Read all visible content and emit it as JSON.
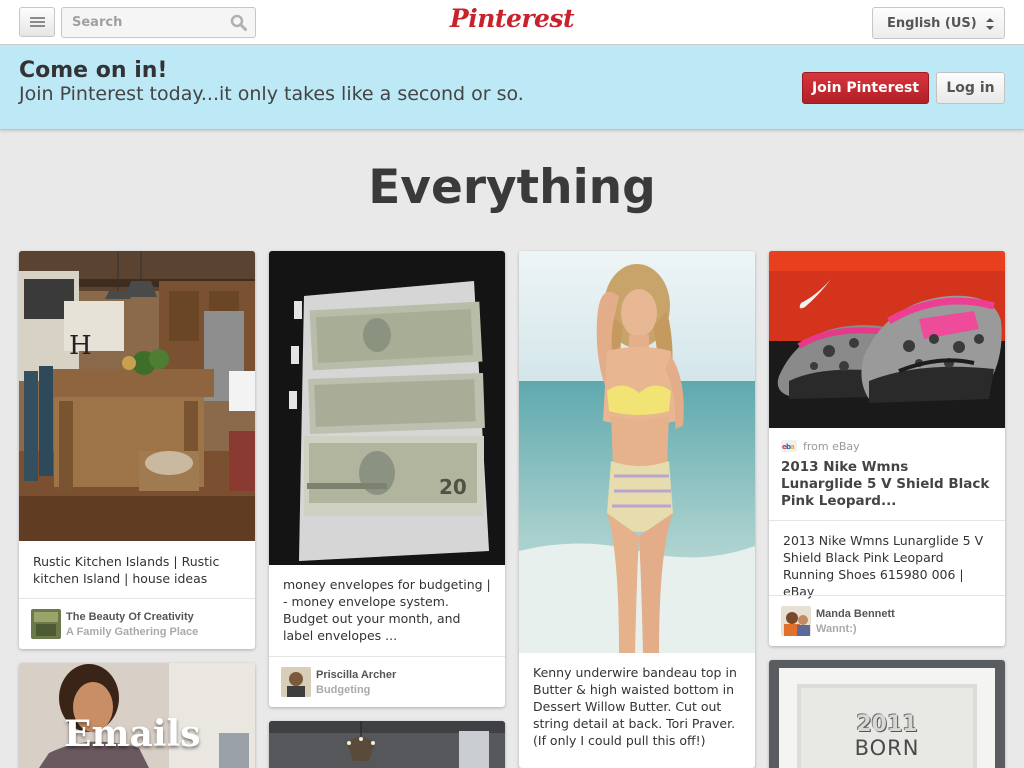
{
  "header": {
    "search_placeholder": "Search",
    "logo_text": "Pinterest",
    "language": "English (US)"
  },
  "banner": {
    "title": "Come on in!",
    "subtitle": "Join Pinterest today...it only takes like a second or so.",
    "join_label": "Join Pinterest",
    "login_label": "Log in"
  },
  "page": {
    "title": "Everything"
  },
  "pins": [
    {
      "description": "Rustic Kitchen Islands | Rustic kitchen Island | house ideas",
      "user": "The Beauty Of Creativity",
      "board": "A Family Gathering Place"
    },
    {
      "description": "money envelopes for budgeting | - money envelope system. Budget out your month, and label envelopes ...",
      "user": "Priscilla Archer",
      "board": "Budgeting"
    },
    {
      "description": "Kenny underwire bandeau top in Butter & high waisted bottom in Dessert Willow Butter. Cut out string detail at back. Tori Praver. (If only I could pull this off!)"
    },
    {
      "source": "from eBay",
      "title": "2013 Nike Wmns Lunarglide 5 V Shield Black Pink Leopard...",
      "description": "2013 Nike Wmns Lunarglide 5 V Shield Black Pink Leopard Running Shoes 615980 006 | eBay",
      "user": "Manda Bennett",
      "board": "Wannt:)"
    }
  ],
  "partial_pins": [
    {
      "overlay_text": "Emails"
    },
    {},
    {
      "frame_text_1": "2011",
      "frame_text_2": "BORN"
    }
  ],
  "colors": {
    "brand": "#c8232c",
    "banner_bg": "#bde8f5",
    "page_bg": "#e9e9e9"
  },
  "icons": {
    "menu": "menu-icon",
    "search": "search-icon",
    "select": "select-arrows-icon",
    "source": "ebay-icon"
  }
}
